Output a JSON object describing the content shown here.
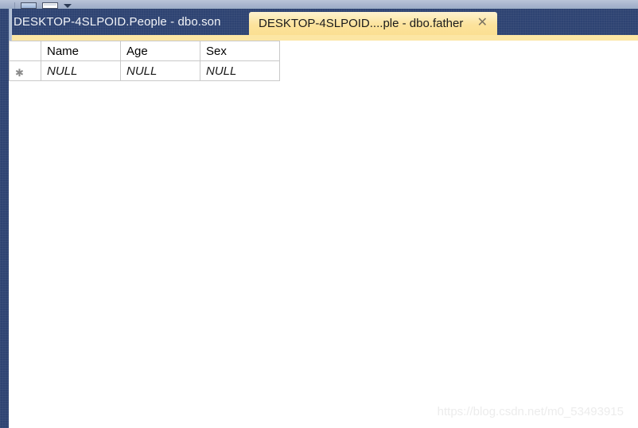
{
  "toolbar": {
    "icons": [
      {
        "name": "panel-icon",
        "label": ""
      },
      {
        "name": "window-icon",
        "label": ""
      },
      {
        "name": "chevron-down-icon",
        "label": ""
      }
    ]
  },
  "tabs": {
    "inactive": {
      "label": "DESKTOP-4SLPOID.People - dbo.son"
    },
    "active": {
      "label": "DESKTOP-4SLPOID....ple - dbo.father",
      "close_label": "✕"
    }
  },
  "grid": {
    "row_marker": "✱",
    "columns": [
      "Name",
      "Age",
      "Sex"
    ],
    "rows": [
      {
        "marker": "✱",
        "cells": [
          "NULL",
          "NULL",
          "NULL"
        ]
      }
    ]
  },
  "watermark": {
    "text": "https://blog.csdn.net/m0_53493915"
  },
  "colors": {
    "tab_band": "#2e4372",
    "active_tab": "#fce39c",
    "tab_strip": "#fce6a4",
    "toolbar": "#a7b4cd",
    "grid_border": "#c9c9c9"
  }
}
